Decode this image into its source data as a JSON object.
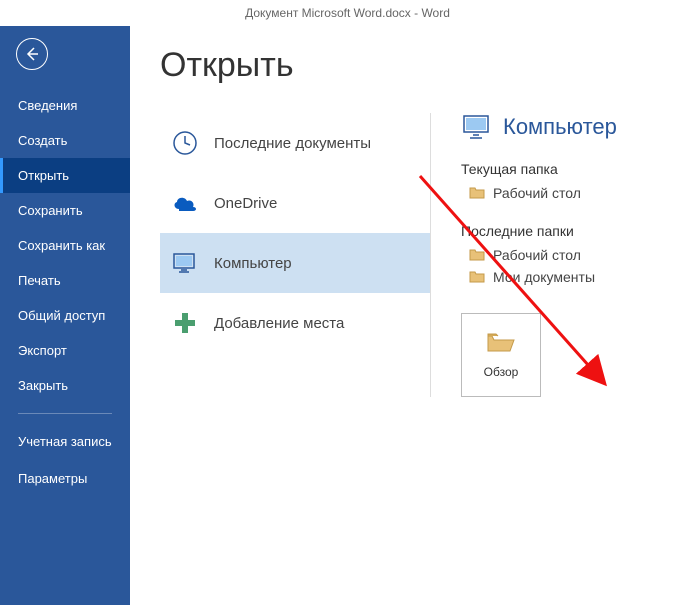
{
  "window_title": "Документ Microsoft Word.docx - Word",
  "sidebar": {
    "items": [
      {
        "label": "Сведения"
      },
      {
        "label": "Создать"
      },
      {
        "label": "Открыть"
      },
      {
        "label": "Сохранить"
      },
      {
        "label": "Сохранить как"
      },
      {
        "label": "Печать"
      },
      {
        "label": "Общий доступ"
      },
      {
        "label": "Экспорт"
      },
      {
        "label": "Закрыть"
      }
    ],
    "footer": [
      {
        "label": "Учетная запись"
      },
      {
        "label": "Параметры"
      }
    ]
  },
  "page_title": "Открыть",
  "sources": [
    {
      "label": "Последние документы"
    },
    {
      "label": "OneDrive"
    },
    {
      "label": "Компьютер"
    },
    {
      "label": "Добавление места"
    }
  ],
  "detail": {
    "title": "Компьютер",
    "current_label": "Текущая папка",
    "current_folder": "Рабочий стол",
    "recent_label": "Последние папки",
    "recent_folders": [
      "Рабочий стол",
      "Мои документы"
    ],
    "browse_label": "Обзор"
  }
}
